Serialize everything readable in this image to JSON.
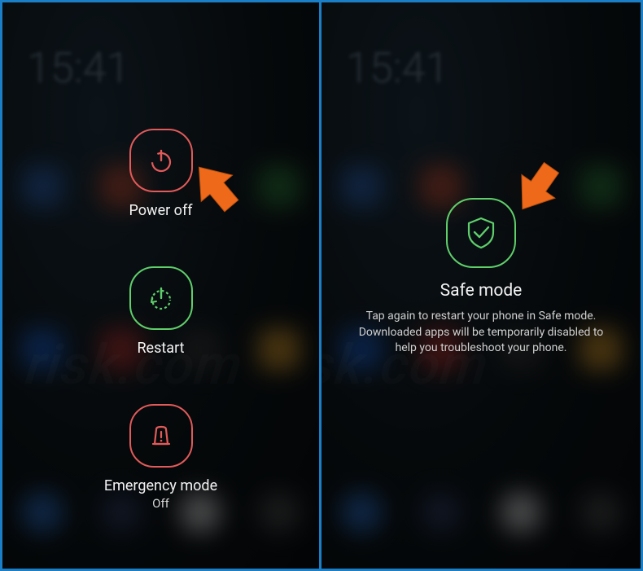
{
  "powerMenu": {
    "items": [
      {
        "label": "Power off"
      },
      {
        "label": "Restart"
      },
      {
        "label": "Emergency mode",
        "sub": "Off"
      }
    ]
  },
  "safeMode": {
    "title": "Safe mode",
    "description": "Tap again to restart your phone in Safe mode. Downloaded apps will be temporarily disabled to help you troubleshoot your phone."
  },
  "clock": "15:41",
  "colors": {
    "frameBorder": "#1b7fc7",
    "red": "#e25a5a",
    "green": "#5fcf6b",
    "arrow": "#ee6a1a"
  }
}
